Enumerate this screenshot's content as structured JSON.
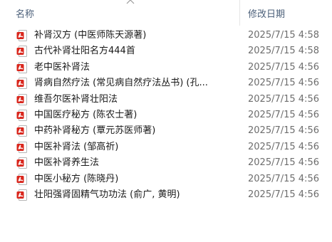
{
  "header": {
    "name_label": "名称",
    "date_label": "修改日期"
  },
  "colors": {
    "pdf_icon_red": "#d9261c",
    "header_text": "#4c607a",
    "date_text": "#6d6d6d"
  },
  "files": [
    {
      "name": "补肾汉方 (中医师陈天源著)",
      "date": "2025/7/15 4:58",
      "icon": "pdf-file-icon"
    },
    {
      "name": "古代补肾壮阳名方444首",
      "date": "2025/7/15 4:58",
      "icon": "pdf-file-icon"
    },
    {
      "name": "老中医补肾法",
      "date": "2025/7/15 4:56",
      "icon": "pdf-file-icon"
    },
    {
      "name": "肾病自然疗法 (常见病自然疗法丛书) (孔...",
      "date": "2025/7/15 4:56",
      "icon": "pdf-file-icon"
    },
    {
      "name": "维吾尔医补肾壮阳法",
      "date": "2025/7/15 4:56",
      "icon": "pdf-file-icon"
    },
    {
      "name": "中国医疗秘方 (陈农士著)",
      "date": "2025/7/15 4:56",
      "icon": "pdf-file-icon"
    },
    {
      "name": "中药补肾秘方 (覃元苏医师著)",
      "date": "2025/7/15 4:56",
      "icon": "pdf-file-icon"
    },
    {
      "name": "中医补肾法 (邹高祈)",
      "date": "2025/7/15 4:56",
      "icon": "pdf-file-icon"
    },
    {
      "name": "中医补肾养生法",
      "date": "2025/7/15 4:56",
      "icon": "pdf-file-icon"
    },
    {
      "name": "中医小秘方 (陈晓丹)",
      "date": "2025/7/15 4:56",
      "icon": "pdf-file-icon"
    },
    {
      "name": "壮阳强肾固精气功功法 (俞广, 黄明)",
      "date": "2025/7/15 4:56",
      "icon": "pdf-file-icon"
    }
  ]
}
